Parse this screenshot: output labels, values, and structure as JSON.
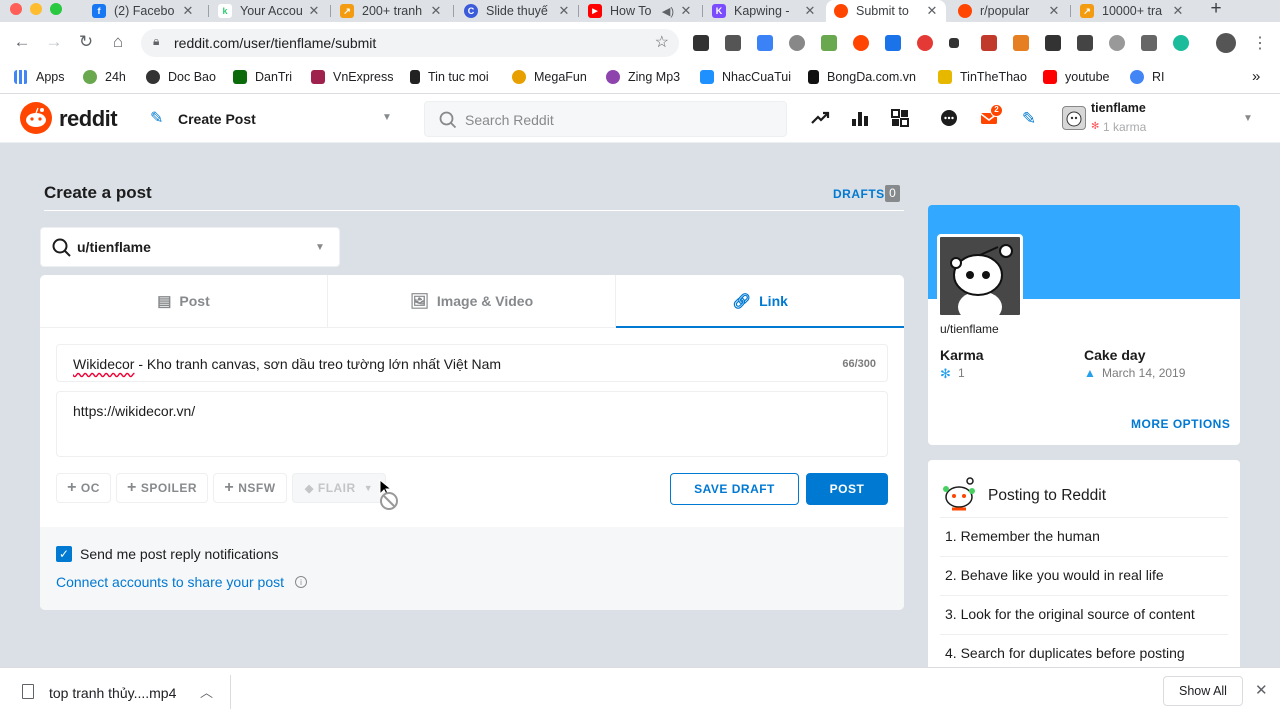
{
  "browser": {
    "tabs": [
      {
        "label": "(2) Facebo",
        "color": "#1877f2",
        "glyph": "f"
      },
      {
        "label": "Your Accou",
        "color": "#ffffff",
        "glyph": "k"
      },
      {
        "label": "200+ tranh",
        "color": "#f39c12",
        "glyph": "↗"
      },
      {
        "label": "Slide thuyế",
        "color": "#3b5bdb",
        "glyph": "C"
      },
      {
        "label": "How To",
        "color": "#ff0000",
        "glyph": "▶"
      },
      {
        "label": "Kapwing -",
        "color": "#7c4dff",
        "glyph": "K"
      },
      {
        "label": "Submit to",
        "color": "#ff4500",
        "glyph": "●"
      },
      {
        "label": "r/popular",
        "color": "#ff4500",
        "glyph": "●"
      },
      {
        "label": "10000+ tra",
        "color": "#f39c12",
        "glyph": "↗"
      }
    ],
    "url": "reddit.com/user/tienflame/submit",
    "bookmarks": [
      {
        "label": "Apps",
        "color": "#4285f4"
      },
      {
        "label": "24h",
        "color": "#6aa84f"
      },
      {
        "label": "Doc Bao",
        "color": "#333333"
      },
      {
        "label": "DanTri",
        "color": "#0b6b0b"
      },
      {
        "label": "VnExpress",
        "color": "#9f224e"
      },
      {
        "label": "Tin tuc moi",
        "color": "#222222"
      },
      {
        "label": "MegaFun",
        "color": "#e8a000"
      },
      {
        "label": "Zing Mp3",
        "color": "#8e44ad"
      },
      {
        "label": "NhacCuaTui",
        "color": "#1e90ff"
      },
      {
        "label": "BongDa.com.vn",
        "color": "#111111"
      },
      {
        "label": "TinTheThao",
        "color": "#e6b800"
      },
      {
        "label": "youtube",
        "color": "#ff0000"
      },
      {
        "label": "RI",
        "color": "#4285f4"
      }
    ],
    "overflow": "»"
  },
  "header": {
    "logo_text": "reddit",
    "create_post": "Create Post",
    "search_placeholder": "Search Reddit",
    "notification_count": "2",
    "username": "tienflame",
    "karma": "1 karma"
  },
  "main": {
    "title": "Create a post",
    "drafts_label": "DRAFTS",
    "drafts_count": "0",
    "community": "u/tienflame",
    "tabs": [
      {
        "label": "Post",
        "icon": "post-icon"
      },
      {
        "label": "Image & Video",
        "icon": "image-icon"
      },
      {
        "label": "Link",
        "icon": "link-icon"
      }
    ],
    "post_title_spellchecked": "Wikidecor",
    "post_title_rest": " - Kho tranh canvas, sơn dầu treo tường lớn nhất Việt Nam",
    "title_counter": "66/300",
    "url_value": "https://wikidecor.vn/",
    "tag_buttons": {
      "oc": "OC",
      "spoiler": "SPOILER",
      "nsfw": "NSFW",
      "flair": "FLAIR"
    },
    "save_draft": "SAVE DRAFT",
    "post": "POST",
    "notify_label": "Send me post reply notifications",
    "notify_checked": true,
    "connect_link": "Connect accounts to share your post"
  },
  "sidebar": {
    "profile_name": "u/tienflame",
    "karma_label": "Karma",
    "karma_value": "1",
    "cake_label": "Cake day",
    "cake_value": "March 14, 2019",
    "more_options": "MORE OPTIONS",
    "rules_title": "Posting to Reddit",
    "rules": [
      "1. Remember the human",
      "2. Behave like you would in real life",
      "3. Look for the original source of content",
      "4. Search for duplicates before posting"
    ]
  },
  "download_bar": {
    "file_name": "top tranh thủy....mp4",
    "show_all": "Show All"
  },
  "colors": {
    "accent": "#0079d3",
    "brand": "#ff4500",
    "banner": "#33a8ff"
  }
}
